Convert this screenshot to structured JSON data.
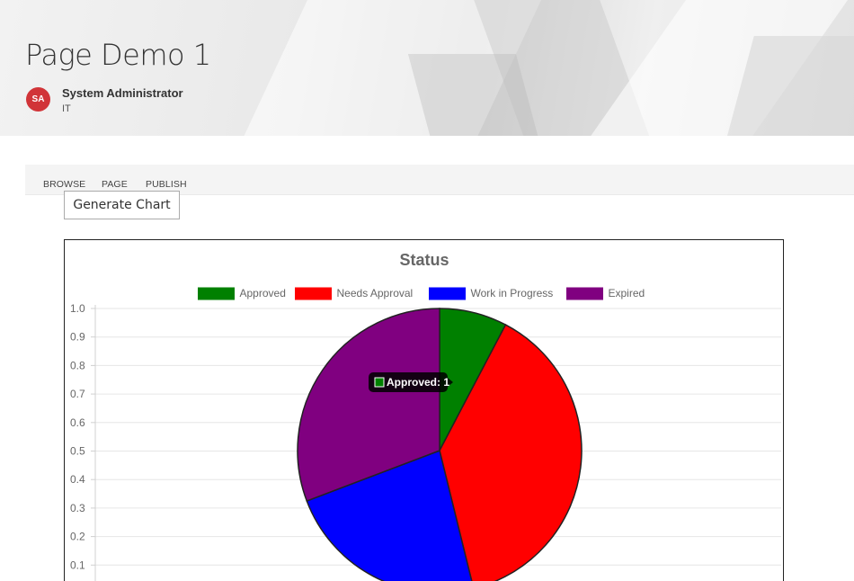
{
  "page": {
    "title": "Page Demo 1",
    "author": {
      "initials": "SA",
      "name": "System Administrator",
      "department": "IT"
    }
  },
  "ribbon": {
    "tabs": [
      "BROWSE",
      "PAGE",
      "PUBLISH"
    ]
  },
  "button": {
    "generate_label": "Generate Chart"
  },
  "colors": {
    "approved": "#008000",
    "needs_approval": "#ff0000",
    "work_in_progress": "#0000ff",
    "expired": "#800080",
    "avatar": "#d13438"
  },
  "chart_data": {
    "type": "pie",
    "title": "Status",
    "categories": [
      "Approved",
      "Needs Approval",
      "Work in Progress",
      "Expired"
    ],
    "values": [
      1,
      5,
      3,
      4
    ],
    "colors": [
      "#008000",
      "#ff0000",
      "#0000ff",
      "#800080"
    ],
    "legend_position": "top",
    "y_ticks": [
      "1.0",
      "0.9",
      "0.8",
      "0.7",
      "0.6",
      "0.5",
      "0.4",
      "0.3",
      "0.2",
      "0.1"
    ],
    "ylim": [
      0,
      1.0
    ],
    "grid": true,
    "tooltip": {
      "text": "Approved: 1",
      "series_index": 0
    }
  }
}
